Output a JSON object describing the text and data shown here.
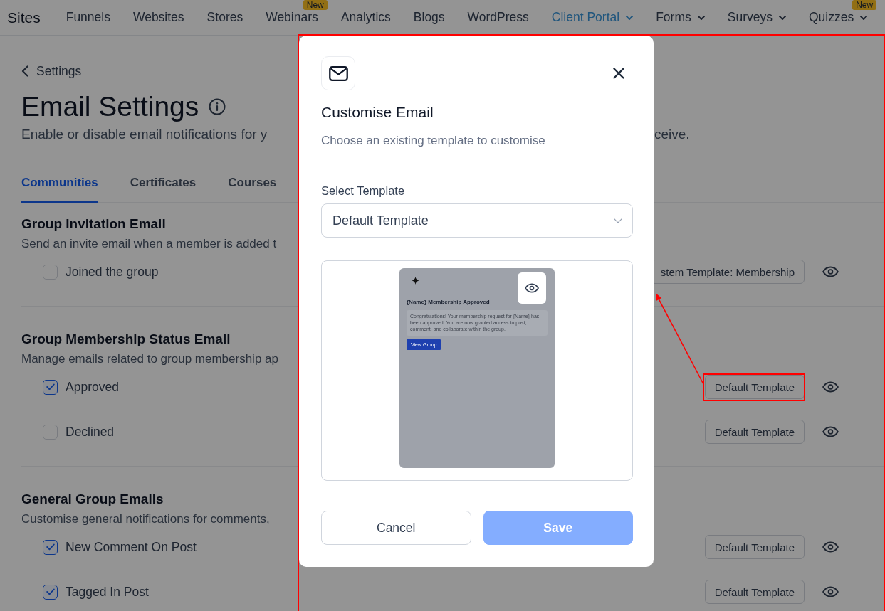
{
  "nav": {
    "title": "Sites",
    "items": [
      {
        "label": "Funnels",
        "selected": false,
        "has_menu": false
      },
      {
        "label": "Websites",
        "selected": false,
        "has_menu": false
      },
      {
        "label": "Stores",
        "selected": false,
        "has_menu": false
      },
      {
        "label": "Webinars",
        "selected": false,
        "has_menu": false,
        "badge": "New"
      },
      {
        "label": "Analytics",
        "selected": false,
        "has_menu": false
      },
      {
        "label": "Blogs",
        "selected": false,
        "has_menu": false
      },
      {
        "label": "WordPress",
        "selected": false,
        "has_menu": false
      },
      {
        "label": "Client Portal",
        "selected": true,
        "has_menu": true
      },
      {
        "label": "Forms",
        "selected": false,
        "has_menu": true
      },
      {
        "label": "Surveys",
        "selected": false,
        "has_menu": true
      },
      {
        "label": "Quizzes",
        "selected": false,
        "has_menu": true,
        "badge": "New"
      }
    ]
  },
  "page": {
    "back_link": "Settings",
    "title": "Email Settings",
    "subtitle": "Enable or disable email notifications for y",
    "subtitle_tail": "ceive.",
    "tabs": [
      {
        "label": "Communities",
        "selected": true
      },
      {
        "label": "Certificates",
        "selected": false
      },
      {
        "label": "Courses",
        "selected": false
      }
    ]
  },
  "sections": [
    {
      "title": "Group Invitation Email",
      "description": "Send an invite email when a member is added t",
      "rows": [
        {
          "label": "Joined the group",
          "checked": false,
          "template": {
            "label": "stem Template: Membership",
            "highlighted": false
          }
        }
      ]
    },
    {
      "title": "Group Membership Status Email",
      "description": "Manage emails related to group membership ap",
      "rows": [
        {
          "label": "Approved",
          "checked": true,
          "template": {
            "label": "Default Template",
            "highlighted": true
          }
        },
        {
          "label": "Declined",
          "checked": false,
          "template": {
            "label": "Default Template",
            "highlighted": false
          }
        }
      ]
    },
    {
      "title": "General Group Emails",
      "description": "Customise general notifications for comments,",
      "rows": [
        {
          "label": "New Comment On Post",
          "checked": true,
          "template": {
            "label": "Default Template",
            "highlighted": false
          }
        },
        {
          "label": "Tagged In Post",
          "checked": true,
          "template": {
            "label": "Default Template",
            "highlighted": false
          }
        }
      ]
    }
  ],
  "dialog": {
    "highlighted": true,
    "title": "Customise Email",
    "subtitle": "Choose an existing template to customise",
    "field_label": "Select Template",
    "value": "Default Template",
    "preview": {
      "heading": "{Name} Membership Approved",
      "message": "Congratulations! Your membership request for {Name} has been approved. You are now granted access to post, comment, and collaborate within the group.",
      "button": "View Group"
    },
    "buttons": [
      {
        "label": "Cancel",
        "kind": "secondary",
        "disabled": false
      },
      {
        "label": "Save",
        "kind": "primary",
        "disabled": true
      }
    ]
  }
}
